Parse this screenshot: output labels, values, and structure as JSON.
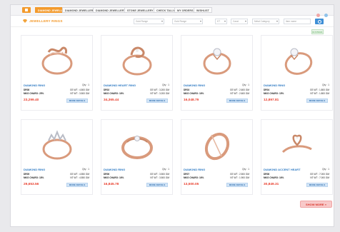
{
  "nav": {
    "home_icon": "home-icon",
    "items": [
      {
        "label": "DIAMOND JEWELLERY",
        "active": true
      },
      {
        "label": "DIAMOND JEWELLERY"
      },
      {
        "label": "DIAMOND JEWELLERY"
      },
      {
        "label": "STONE JEWELLERY"
      },
      {
        "label": "CHECK TALLY"
      },
      {
        "label": "MY ORDERS"
      },
      {
        "label": "WISHLIST"
      }
    ],
    "dot_colors": [
      "#f0a6a6",
      "#8fc2ea"
    ]
  },
  "page": {
    "title": "JEWELLERY RINGS",
    "stock_label": "IN STOCK"
  },
  "filters": {
    "gold_range": "Gold Range",
    "gold_range_2": "Gold Range",
    "kt": "KT",
    "carat": "Carat",
    "metal_category": "Metal Category",
    "item_name": "Item name"
  },
  "products": [
    {
      "name": "DIAMOND RING",
      "qty": "Qty : 1",
      "code": "DR08",
      "charge": "MKG CHARG: 25%",
      "wt1": "GS WT : 4.500 GM",
      "wt2": "NT WT : 3.500 GM",
      "price": "23,299.40",
      "button": "MORE DETAILS"
    },
    {
      "name": "DIAMOND HEART RING",
      "qty": "Qty : 1",
      "code": "DR02",
      "charge": "MKG CHARG: 16%",
      "wt1": "GS WT : 3.200 GM",
      "wt2": "NT WT : 3.200 GM",
      "price": "34,365.44",
      "button": "MORE DETAILS"
    },
    {
      "name": "DIAMOND RING",
      "qty": "Qty : 1",
      "code": "DR03",
      "charge": "MKG CHARG: 16%",
      "wt1": "GS WT : 2.600 GM",
      "wt2": "NT WT : 2.600 GM",
      "price": "16,048.79",
      "button": "MORE DETAILS"
    },
    {
      "name": "DIAMOND RING",
      "qty": "Qty : 1",
      "code": "DR04",
      "charge": "MKG CHARG: 15%",
      "wt1": "GS WT : 1.800 GM",
      "wt2": "NT WT : 1.800 GM",
      "price": "12,897.81",
      "button": "MORE DETAILS"
    },
    {
      "name": "DIAMOND RING",
      "qty": "Qty : 1",
      "code": "DR05",
      "charge": "MKG CHARG: 18%",
      "wt1": "GS WT : 4.550 GM",
      "wt2": "NT WT : 4.550 GM",
      "price": "29,653.56",
      "button": "MORE DETAILS"
    },
    {
      "name": "DIAMOND RING",
      "qty": "Qty : 1",
      "code": "DR06",
      "charge": "MKG CHARG: 16%",
      "wt1": "GS WT : 3.500 GM",
      "wt2": "NT WT : 3.500 GM",
      "price": "16,845.78",
      "button": "MORE DETAILS"
    },
    {
      "name": "DIAMOND RING",
      "qty": "Qty : 1",
      "code": "DR07",
      "charge": "MKG CHARG: 16%",
      "wt1": "GS WT : 2.500 GM",
      "wt2": "NT WT : 1.900 GM",
      "price": "13,500.05",
      "button": "MORE DETAILS"
    },
    {
      "name": "DIAMOND ACCENT HEART",
      "qty": "Qty : 1",
      "code": "DR08",
      "charge": "MKG CHARG: 16%",
      "wt1": "GS WT : 7.000 GM",
      "wt2": "NT WT : 7.000 GM",
      "price": "30,849.31",
      "button": "MORE DETAILS"
    }
  ],
  "show_more": "SHOW MORE »",
  "colors": {
    "accent": "#f39a2c",
    "price": "#e8402f",
    "name": "#2f7bc4",
    "rose_gold": "#d99a7c"
  }
}
